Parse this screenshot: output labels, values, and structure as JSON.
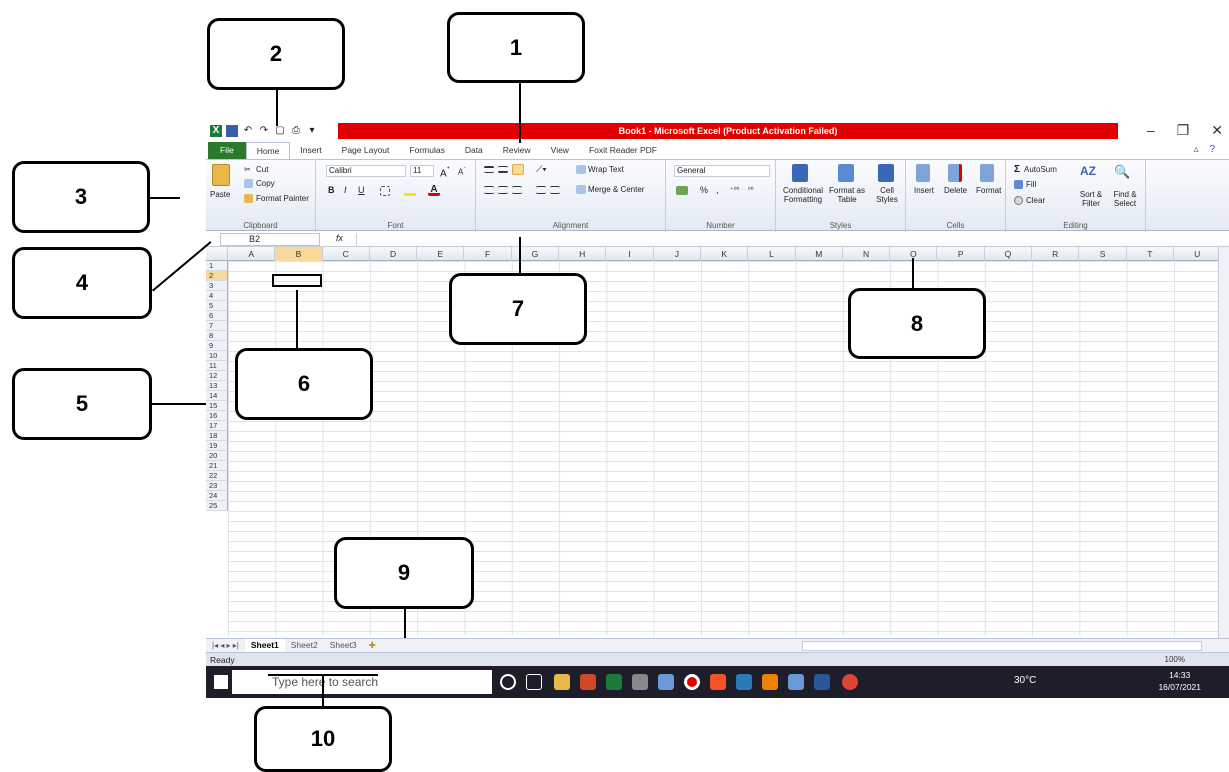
{
  "window": {
    "title": "Book1 - Microsoft Excel (Product Activation Failed)",
    "title_bar_color": "#e00000"
  },
  "quick_access": {
    "icons": [
      "excel-logo-icon",
      "save-icon",
      "undo-icon",
      "redo-icon",
      "print-preview-icon",
      "print-icon",
      "customize-icon"
    ]
  },
  "tabs": [
    "File",
    "Home",
    "Insert",
    "Page Layout",
    "Formulas",
    "Data",
    "Review",
    "View",
    "Foxit Reader PDF"
  ],
  "active_tab": "Home",
  "ribbon": {
    "clipboard": {
      "label": "Clipboard",
      "paste": "Paste",
      "cut": "Cut",
      "copy": "Copy",
      "format_painter": "Format Painter"
    },
    "font": {
      "label": "Font",
      "family": "Calibri",
      "size": "11",
      "bold": "B",
      "italic": "I",
      "underline": "U"
    },
    "alignment": {
      "label": "Alignment",
      "wrap_text": "Wrap Text",
      "merge_center": "Merge & Center"
    },
    "number": {
      "label": "Number",
      "format": "General",
      "percent": "%",
      "comma": ","
    },
    "styles": {
      "label": "Styles",
      "conditional": "Conditional Formatting",
      "format_table": "Format as Table",
      "cell_styles": "Cell Styles"
    },
    "cells": {
      "label": "Cells",
      "insert": "Insert",
      "delete": "Delete",
      "format": "Format"
    },
    "editing": {
      "label": "Editing",
      "autosum": "AutoSum",
      "fill": "Fill",
      "clear": "Clear",
      "sort_filter": "Sort & Filter",
      "find_select": "Find & Select"
    }
  },
  "formula_bar": {
    "name_box": "B2",
    "fx": "fx",
    "content": ""
  },
  "columns": [
    "A",
    "B",
    "C",
    "D",
    "E",
    "F",
    "G",
    "H",
    "I",
    "J",
    "K",
    "L",
    "M",
    "N",
    "O",
    "P",
    "Q",
    "R",
    "S",
    "T",
    "U"
  ],
  "selected_column": "B",
  "rows": [
    "1",
    "2",
    "3",
    "4",
    "5",
    "6",
    "7",
    "8",
    "9",
    "10",
    "11",
    "12",
    "13",
    "14",
    "15",
    "16",
    "17",
    "18",
    "19",
    "20",
    "21",
    "22",
    "23",
    "24",
    "25"
  ],
  "selected_row": "2",
  "sheets": [
    "Sheet1",
    "Sheet2",
    "Sheet3"
  ],
  "active_sheet": "Sheet1",
  "status": {
    "text": "Ready",
    "zoom": "100%"
  },
  "taskbar": {
    "search_placeholder": "Type here to search",
    "temperature": "30°C",
    "time": "14:33",
    "date": "16/07/2021"
  },
  "callouts": [
    "1",
    "2",
    "3",
    "4",
    "5",
    "6",
    "7",
    "8",
    "9",
    "10"
  ]
}
